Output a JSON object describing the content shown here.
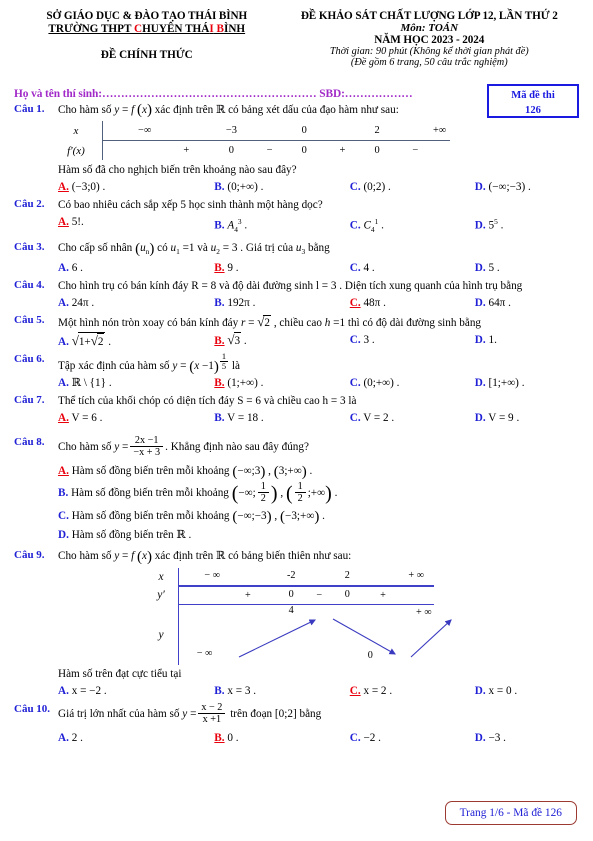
{
  "header": {
    "dept_line1": "SỞ GIÁO DỤC & ĐÀO TẠO THÁI BÌNH",
    "school_pre": "TRƯỜNG THPT ",
    "school_c": "C",
    "school_mid": "HUYÊN THÁ",
    "school_i": "I",
    "school_sp": " ",
    "school_b": "B",
    "school_end": "ÌNH",
    "official": "ĐỀ CHÍNH THỨC",
    "exam_title": "ĐỀ KHẢO SÁT CHẤT LƯỢNG LỚP 12, LẦN THỨ 2",
    "subject": "Môn: TOÁN",
    "school_year": "NĂM HỌC 2023 - 2024",
    "time": "Thời gian: 90 phút (Không kể thời gian phát đề)",
    "pages_note": "(Đề gồm 6 trang, 50 câu trắc nghiệm)",
    "code_label": "Mã đề thi",
    "code_value": "126",
    "candidate_line": "Họ và tên thí sinh:………………………………………………… SBD:………………"
  },
  "colors": {
    "question_number": "#2020d6",
    "option_letter": "#2020d6",
    "correct": "#e8000d",
    "candidate_line": "#a12ac8",
    "table_rule": "#51607d",
    "var_table_rule": "#4040c8",
    "footer_border": "#9c3a32",
    "code_box_border": "#1a1ae0"
  },
  "questions": [
    {
      "num": "Câu 1.",
      "stem_pre": "Cho hàm số ",
      "stem_post": " xác định trên ℝ có bảng xét dấu của đạo hàm như sau:",
      "sub_question": "Hàm số đã cho nghịch biến trên khoảng nào sau đây?",
      "sign_table": {
        "row1_label": "x",
        "row2_label": "f′(x)",
        "x_values": [
          "−∞",
          "−3",
          "0",
          "2",
          "+∞"
        ],
        "signs": [
          "+",
          "0",
          "−",
          "0",
          "+",
          "0",
          "−"
        ]
      },
      "options": [
        {
          "letter": "A.",
          "text": "(−3;0) .",
          "correct": true
        },
        {
          "letter": "B.",
          "text": "(0;+∞) .",
          "correct": false
        },
        {
          "letter": "C.",
          "text": "(0;2) .",
          "correct": false
        },
        {
          "letter": "D.",
          "text": "(−∞;−3) .",
          "correct": false
        }
      ]
    },
    {
      "num": "Câu 2.",
      "stem": "Có bao nhiêu cách sắp xếp 5 học sinh thành một hàng dọc?",
      "options": [
        {
          "letter": "A.",
          "text": "5!.",
          "correct": true
        },
        {
          "letter": "B.",
          "text": "A₄³ .",
          "correct": false
        },
        {
          "letter": "C.",
          "text": "C₄¹ .",
          "correct": false
        },
        {
          "letter": "D.",
          "text": "5⁵ .",
          "correct": false
        }
      ]
    },
    {
      "num": "Câu 3.",
      "stem": "Cho cấp số nhân (uₙ) có u₁ = 1 và u₂ = 3 . Giá trị của u₃ bằng",
      "options": [
        {
          "letter": "A.",
          "text": "6 .",
          "correct": false
        },
        {
          "letter": "B.",
          "text": "9 .",
          "correct": true
        },
        {
          "letter": "C.",
          "text": "4 .",
          "correct": false
        },
        {
          "letter": "D.",
          "text": "5 .",
          "correct": false
        }
      ]
    },
    {
      "num": "Câu 4.",
      "stem": "Cho hình trụ có bán kính đáy R = 8 và độ dài đường sinh l = 3 . Diện tích xung quanh của hình trụ bằng",
      "options": [
        {
          "letter": "A.",
          "text": "24π .",
          "correct": false
        },
        {
          "letter": "B.",
          "text": "192π .",
          "correct": false
        },
        {
          "letter": "C.",
          "text": "48π .",
          "correct": true
        },
        {
          "letter": "D.",
          "text": "64π .",
          "correct": false
        }
      ]
    },
    {
      "num": "Câu 5.",
      "stem": "Một hình nón tròn xoay có bán kính đáy r = √2 , chiều cao h = 1 thì có độ dài đường sinh bằng",
      "options": [
        {
          "letter": "A.",
          "text": "√(1+√2) .",
          "correct": false
        },
        {
          "letter": "B.",
          "text": "√3 .",
          "correct": true
        },
        {
          "letter": "C.",
          "text": "3 .",
          "correct": false
        },
        {
          "letter": "D.",
          "text": "1.",
          "correct": false
        }
      ]
    },
    {
      "num": "Câu 6.",
      "stem": "Tập xác định của hàm số y = (x−1)^(1/5) là",
      "options": [
        {
          "letter": "A.",
          "text": "ℝ \\ {1} .",
          "correct": false
        },
        {
          "letter": "B.",
          "text": "(1;+∞) .",
          "correct": true
        },
        {
          "letter": "C.",
          "text": "(0;+∞) .",
          "correct": false
        },
        {
          "letter": "D.",
          "text": "[1;+∞) .",
          "correct": false
        }
      ]
    },
    {
      "num": "Câu 7.",
      "stem": "Thể tích của khối chóp có diện tích đáy S = 6 và chiều cao h = 3 là",
      "options": [
        {
          "letter": "A.",
          "text": "V = 6 .",
          "correct": true
        },
        {
          "letter": "B.",
          "text": "V = 18 .",
          "correct": false
        },
        {
          "letter": "C.",
          "text": "V = 2 .",
          "correct": false
        },
        {
          "letter": "D.",
          "text": "V = 9 .",
          "correct": false
        }
      ]
    },
    {
      "num": "Câu 8.",
      "stem_pre": "Cho hàm số ",
      "stem_frac_num": "2x −1",
      "stem_frac_den": "−x + 3",
      "stem_post": ". Khẳng định nào sau đây đúng?",
      "options_vertical": [
        {
          "letter": "A.",
          "text": "Hàm số đồng biến trên mỗi khoảng (−∞;3) , (3;+∞) .",
          "correct": true
        },
        {
          "letter": "B.",
          "text": "Hàm số đồng biến trên mỗi khoảng (−∞; 1/2) , (1/2 ;+∞) .",
          "correct": false
        },
        {
          "letter": "C.",
          "text": "Hàm số đồng biến trên mỗi khoảng (−∞;−3) , (−3;+∞) .",
          "correct": false
        },
        {
          "letter": "D.",
          "text": "Hàm số đồng biến trên ℝ .",
          "correct": false
        }
      ]
    },
    {
      "num": "Câu 9.",
      "stem_pre": "Cho hàm số ",
      "stem_post": " xác định trên ℝ có bảng biến thiên như sau:",
      "sub_question": "Hàm số trên đạt cực tiểu tại",
      "var_table": {
        "row1_label": "x",
        "row2_label": "y′",
        "row3_label": "y",
        "x_values": [
          "− ∞",
          "-2",
          "2",
          "+ ∞"
        ],
        "derivative_signs": [
          "+",
          "0",
          "−",
          "0",
          "+"
        ],
        "y_values": [
          "− ∞",
          "4",
          "0",
          "+ ∞"
        ]
      },
      "options": [
        {
          "letter": "A.",
          "text": "x = −2 .",
          "correct": false
        },
        {
          "letter": "B.",
          "text": "x = 3 .",
          "correct": false
        },
        {
          "letter": "C.",
          "text": "x = 2 .",
          "correct": true
        },
        {
          "letter": "D.",
          "text": "x = 0 .",
          "correct": false
        }
      ]
    },
    {
      "num": "Câu 10.",
      "stem_pre": "Giá trị lớn nhất của hàm số ",
      "stem_frac_num": "x − 2",
      "stem_frac_den": "x +1",
      "stem_post": " trên đoạn [0;2] bằng",
      "options": [
        {
          "letter": "A.",
          "text": "2 .",
          "correct": false
        },
        {
          "letter": "B.",
          "text": "0 .",
          "correct": true
        },
        {
          "letter": "C.",
          "text": "−2 .",
          "correct": false
        },
        {
          "letter": "D.",
          "text": "−3 .",
          "correct": false
        }
      ]
    }
  ],
  "footer": {
    "text": "Trang 1/6 - Mã đề 126"
  }
}
